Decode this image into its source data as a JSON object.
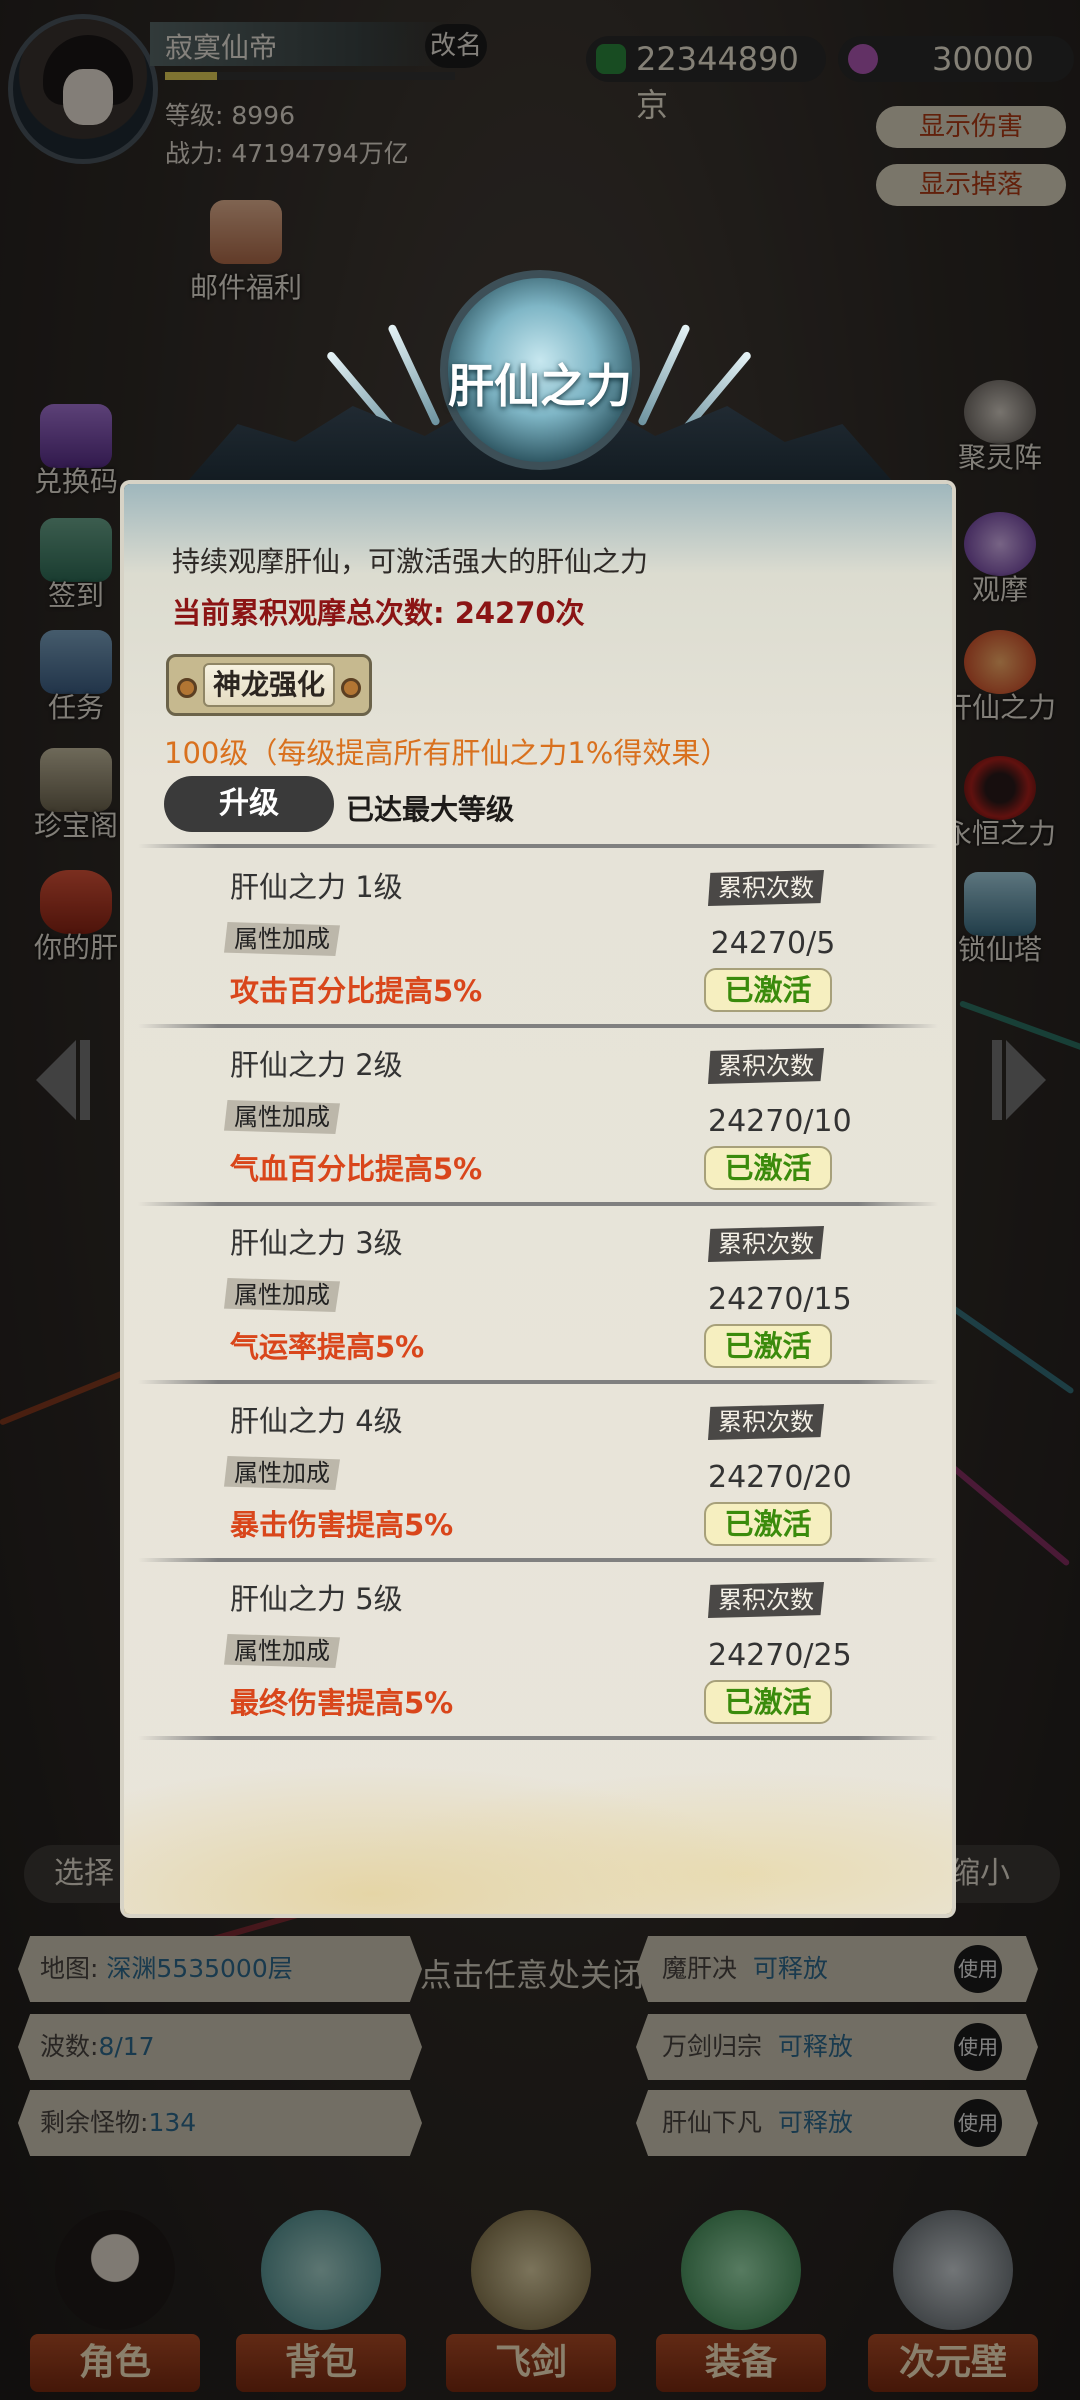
{
  "player": {
    "name": "寂寞仙帝",
    "rename_label": "改名",
    "level_line": "等级: 8996",
    "power_line": "战力: 47194794万亿"
  },
  "currency": {
    "jade": "22344890京",
    "crystal": "30000"
  },
  "toggles": {
    "show_damage": "显示伤害",
    "show_drops": "显示掉落"
  },
  "mail_label": "邮件福利",
  "left_menu": [
    "兑换码",
    "签到",
    "任务",
    "珍宝阁",
    "你的肝"
  ],
  "right_menu": [
    "聚灵阵",
    "观摩",
    "肝仙之力",
    "永恒之力",
    "锁仙塔"
  ],
  "modal": {
    "title": "肝仙之力",
    "description": "持续观摩肝仙，可激活强大的肝仙之力",
    "total_count": "当前累积观摩总次数: 24270次",
    "boost_name": "神龙强化",
    "boost_desc": "100级（每级提高所有肝仙之力1%得效果）",
    "upgrade_label": "升级",
    "max_level_text": "已达最大等级",
    "tiers": [
      {
        "name": "肝仙之力 1级",
        "tag": "属性加成",
        "effect": "攻击百分比提高5%",
        "count_label": "累积次数",
        "progress": "24270/5",
        "status": "已激活"
      },
      {
        "name": "肝仙之力 2级",
        "tag": "属性加成",
        "effect": "气血百分比提高5%",
        "count_label": "累积次数",
        "progress": "24270/10",
        "status": "已激活"
      },
      {
        "name": "肝仙之力 3级",
        "tag": "属性加成",
        "effect": "气运率提高5%",
        "count_label": "累积次数",
        "progress": "24270/15",
        "status": "已激活"
      },
      {
        "name": "肝仙之力 4级",
        "tag": "属性加成",
        "effect": "暴击伤害提高5%",
        "count_label": "累积次数",
        "progress": "24270/20",
        "status": "已激活"
      },
      {
        "name": "肝仙之力 5级",
        "tag": "属性加成",
        "effect": "最终伤害提高5%",
        "count_label": "累积次数",
        "progress": "24270/25",
        "status": "已激活"
      }
    ]
  },
  "bottom": {
    "select_label": "选择",
    "shrink_label": "缩小",
    "hint": "点击任意处关闭",
    "map_label": "地图:",
    "map_value": "深渊5535000层",
    "wave_label": "波数:",
    "wave_value": "8/17",
    "monsters_label": "剩余怪物:",
    "monsters_value": "134",
    "skills": [
      {
        "name": "魔肝决",
        "status": "可释放",
        "use": "使用"
      },
      {
        "name": "万剑归宗",
        "status": "可释放",
        "use": "使用"
      },
      {
        "name": "肝仙下凡",
        "status": "可释放",
        "use": "使用"
      }
    ]
  },
  "nav": [
    "角色",
    "背包",
    "飞剑",
    "装备",
    "次元壁"
  ]
}
